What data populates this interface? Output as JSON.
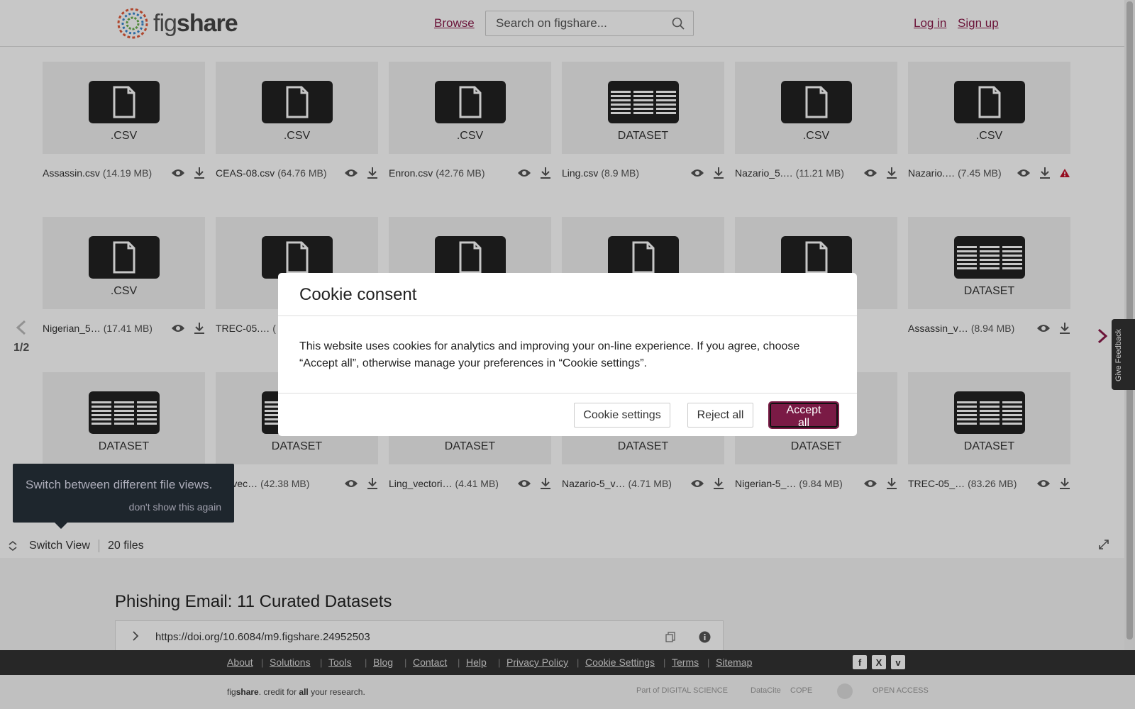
{
  "header": {
    "logo_text_light": "fig",
    "logo_text_bold": "share",
    "browse": "Browse",
    "search_placeholder": "Search on figshare...",
    "login": "Log in",
    "signup": "Sign up"
  },
  "gallery": {
    "page_indicator": "1/2",
    "rows": [
      [
        {
          "type": ".CSV",
          "kind": "file",
          "name": "Assassin.csv",
          "size": "(14.19 MB)"
        },
        {
          "type": ".CSV",
          "kind": "file",
          "name": "CEAS-08.csv",
          "size": "(64.76 MB)"
        },
        {
          "type": ".CSV",
          "kind": "file",
          "name": "Enron.csv",
          "size": "(42.76 MB)"
        },
        {
          "type": "DATASET",
          "kind": "dataset",
          "name": "Ling.csv",
          "size": "(8.9 MB)"
        },
        {
          "type": ".CSV",
          "kind": "file",
          "name": "Nazario_5.…",
          "size": "(11.21 MB)"
        },
        {
          "type": ".CSV",
          "kind": "file",
          "name": "Nazario.…",
          "size": "(7.45 MB)",
          "warning": true
        }
      ],
      [
        {
          "type": ".CSV",
          "kind": "file",
          "name": "Nigerian_5…",
          "size": "(17.41 MB)"
        },
        {
          "type": "",
          "kind": "file",
          "name": "TREC-05.…",
          "size": "("
        },
        {
          "type": "",
          "kind": "file",
          "name": "",
          "size": ""
        },
        {
          "type": "",
          "kind": "file",
          "name": "",
          "size": ""
        },
        {
          "type": "",
          "kind": "file",
          "name": "",
          "size": ""
        },
        {
          "type": "DATASET",
          "kind": "dataset",
          "name": "Assassin_v…",
          "size": "(8.94 MB)"
        }
      ],
      [
        {
          "type": "DATASET",
          "kind": "dataset",
          "name": "",
          "size": ""
        },
        {
          "type": "DATASET",
          "kind": "dataset",
          "name": "on_vec…",
          "size": "(42.38 MB)"
        },
        {
          "type": "DATASET",
          "kind": "dataset",
          "name": "Ling_vectori…",
          "size": "(4.41 MB)"
        },
        {
          "type": "DATASET",
          "kind": "dataset",
          "name": "Nazario-5_v…",
          "size": "(4.71 MB)"
        },
        {
          "type": "DATASET",
          "kind": "dataset",
          "name": "Nigerian-5_…",
          "size": "(9.84 MB)"
        },
        {
          "type": "DATASET",
          "kind": "dataset",
          "name": "TREC-05_…",
          "size": "(83.26 MB)"
        }
      ]
    ]
  },
  "tooltip": {
    "text": "Switch between different file views.",
    "dismiss": "don't show this again"
  },
  "switch_bar": {
    "label": "Switch View",
    "count": "20 files"
  },
  "dataset": {
    "title": "Phishing Email: 11 Curated Datasets",
    "doi": "https://doi.org/10.6084/m9.figshare.24952503"
  },
  "feedback": "Give Feedback",
  "footer": {
    "links": [
      "About",
      "Solutions",
      "Tools",
      "Blog",
      "Contact",
      "Help",
      "Privacy Policy",
      "Cookie Settings",
      "Terms",
      "Sitemap"
    ],
    "social": [
      "f",
      "X",
      "v"
    ],
    "tagline_brand_light": "fig",
    "tagline_brand_bold": "share",
    "tagline_rest1": ". credit for ",
    "tagline_all": "all",
    "tagline_rest2": " your research.",
    "partners": [
      "Part of DIGITAL SCIENCE",
      "DataCite",
      "COPE",
      "",
      "OPEN ACCESS"
    ]
  },
  "modal": {
    "title": "Cookie consent",
    "body": "This website uses cookies for analytics and improving your on-line experience. If you agree, choose “Accept all”, otherwise manage your preferences in “Cookie settings”.",
    "btn_settings": "Cookie settings",
    "btn_reject": "Reject all",
    "btn_accept": "Accept all"
  },
  "colors": {
    "brand": "#8a1a4a",
    "accept": "#7a1a45",
    "footer_dark": "#333333"
  }
}
